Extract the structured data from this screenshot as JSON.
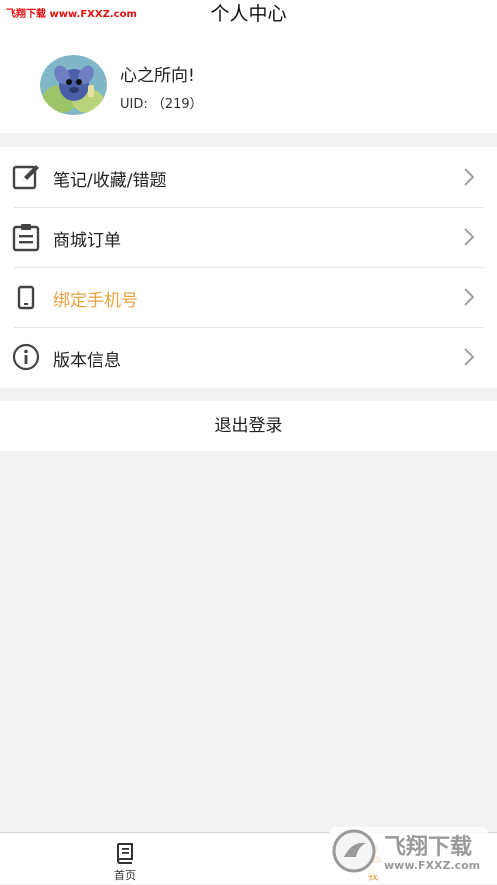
{
  "watermark_top": "飞翔下载 www.FXXZ.com",
  "header": {
    "title": "个人中心"
  },
  "profile": {
    "name": "心之所向!",
    "uid": "UID: （219）"
  },
  "menu": {
    "items": [
      {
        "label": "笔记/收藏/错题",
        "icon": "edit-icon",
        "color": "#222222"
      },
      {
        "label": "商城订单",
        "icon": "clipboard-icon",
        "color": "#222222"
      },
      {
        "label": "绑定手机号",
        "icon": "phone-icon",
        "color": "#e8a33d"
      },
      {
        "label": "版本信息",
        "icon": "info-icon",
        "color": "#222222"
      }
    ]
  },
  "logout": {
    "label": "退出登录"
  },
  "tabbar": {
    "tabs": [
      {
        "label": "首页",
        "icon": "book-icon",
        "active": false
      },
      {
        "label": "我",
        "icon": "user-icon",
        "active": true
      }
    ]
  },
  "watermark_logo": {
    "text": "飞翔下载",
    "url": "www.FXXZ.com"
  },
  "colors": {
    "accent": "#e8a33d",
    "watermark": "#e01010",
    "background": "#f2f2f2"
  }
}
